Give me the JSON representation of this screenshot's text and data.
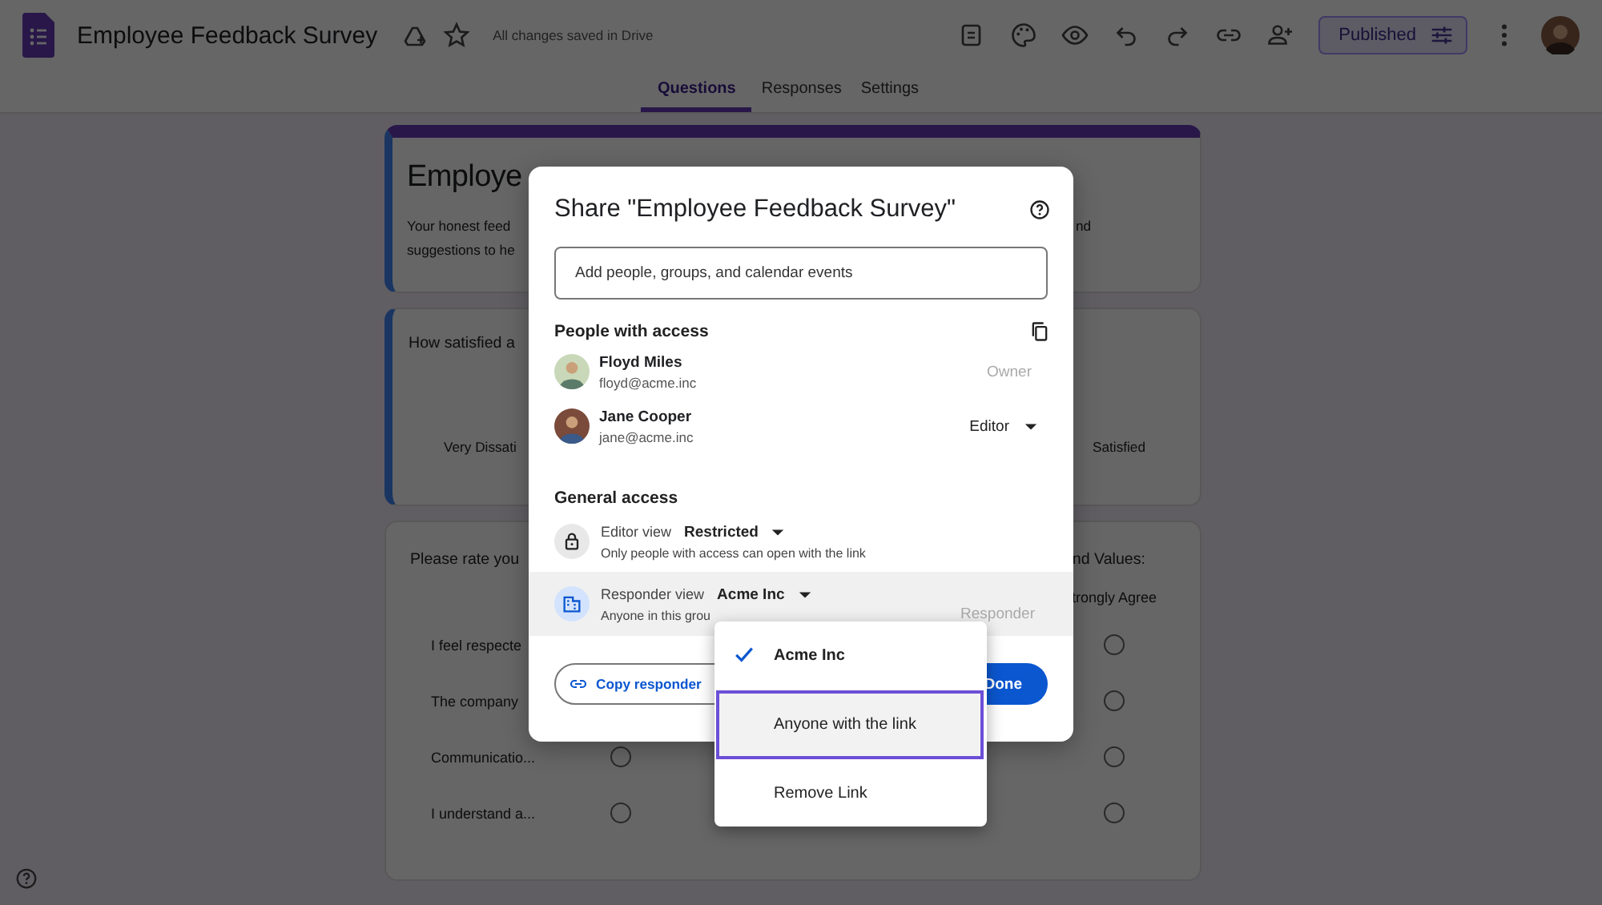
{
  "app": {
    "title": "Employee Feedback Survey",
    "save_status": "All changes saved in Drive",
    "publish_button": "Published"
  },
  "tabs": [
    {
      "label": "Questions",
      "selected": true
    },
    {
      "label": "Responses",
      "selected": false
    },
    {
      "label": "Settings",
      "selected": false
    }
  ],
  "form": {
    "header_card": {
      "title": "Employe",
      "description": [
        {
          "left": "Your honest feed",
          "right": "nd"
        },
        {
          "left": "suggestions to he"
        }
      ]
    },
    "question_cards": [
      {
        "kind": "scale",
        "title_left": "How satisfied a",
        "low_label": "Very Dissati",
        "high_label": "Satisfied"
      },
      {
        "kind": "grid",
        "title_left": "Please rate you",
        "title_right": "nd Values:",
        "column_header": "trongly Agree",
        "rows": [
          {
            "label": "I feel respecte",
            "choices": [
              {
                "checked": false
              }
            ]
          },
          {
            "label": "The company",
            "choices": [
              {
                "checked": false
              }
            ]
          },
          {
            "label": "Communicatio...",
            "choices": [
              {
                "checked": false
              },
              {
                "checked": false
              }
            ]
          },
          {
            "label": "I understand a...",
            "choices": [
              {
                "checked": false
              },
              {
                "checked": false
              }
            ]
          }
        ]
      }
    ]
  },
  "dialog": {
    "title": "Share \"Employee Feedback Survey\"",
    "add_placeholder": "Add people, groups, and calendar events",
    "people_heading": "People with access",
    "people": [
      {
        "name": "Floyd Miles",
        "email": "floyd@acme.inc",
        "role": "Owner",
        "disabled": true
      },
      {
        "name": "Jane Cooper",
        "email": "jane@acme.inc",
        "role": "Editor",
        "disabled": false
      }
    ],
    "general_heading": "General access",
    "access": [
      {
        "label": "Editor view",
        "value": "Restricted",
        "description": "Only people with access can open with the link",
        "highlighted": false
      },
      {
        "label": "Responder view",
        "value": "Acme Inc",
        "description": "Anyone in this grou",
        "role": "Responder",
        "highlighted": true
      }
    ],
    "copy_button": "Copy responder",
    "done_button": "Done"
  },
  "menu": {
    "items": [
      {
        "label": "Acme Inc",
        "selected": true,
        "focused": false
      },
      {
        "label": "Anyone with the link",
        "selected": false,
        "focused": true
      },
      {
        "label": "Remove Link",
        "selected": false,
        "focused": false
      }
    ]
  }
}
